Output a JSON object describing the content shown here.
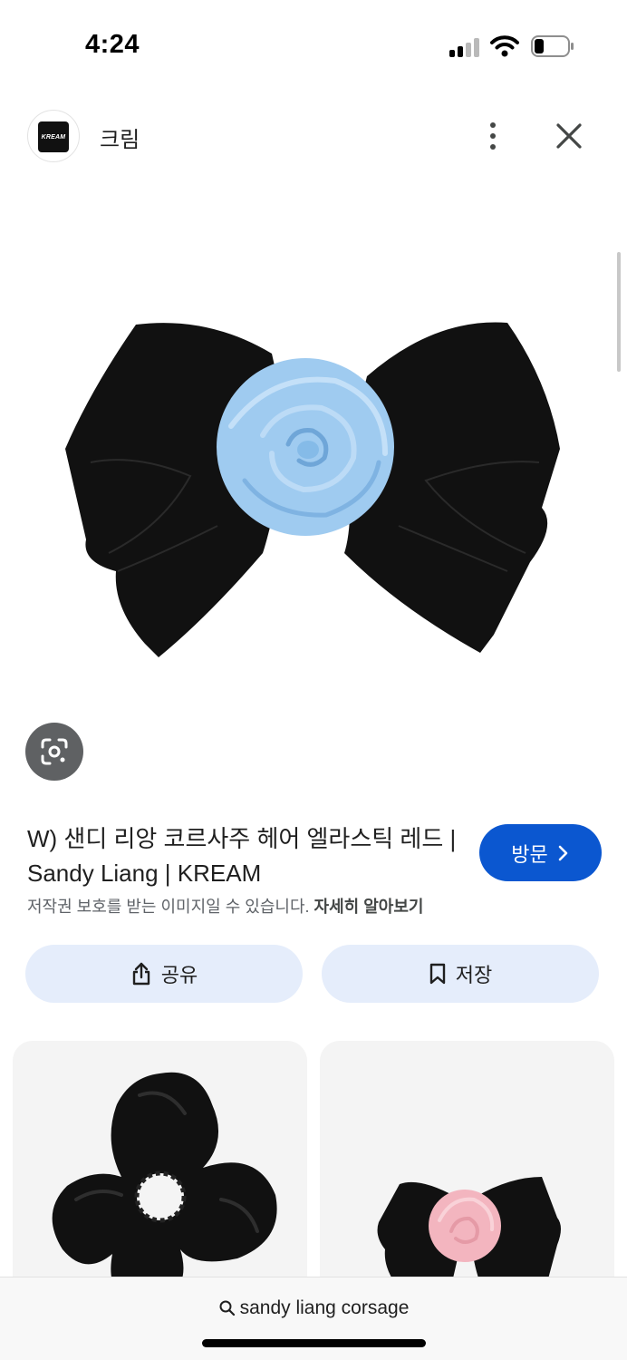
{
  "status_bar": {
    "time": "4:24"
  },
  "header": {
    "logo_text": "KREAM",
    "site_name": "크림"
  },
  "result": {
    "title": "W) 샌디 리앙 코르사주 헤어 엘라스틱 레드 | Sandy Liang | KREAM",
    "copyright_notice": "저작권 보호를 받는 이미지일 수 있습니다.",
    "learn_more": "자세히 알아보기",
    "visit_label": "방문",
    "share_label": "공유",
    "save_label": "저장"
  },
  "search": {
    "query": "sandy liang corsage"
  },
  "colors": {
    "accent_blue": "#0b57d0",
    "chip_background": "#e5edfb",
    "bow_black": "#111111",
    "flower_blue": "#9fcbf0",
    "flower_pink": "#f3b5bf"
  },
  "icons": {
    "lens": "lens-icon",
    "share": "share-icon",
    "save": "bookmark-icon",
    "more": "more-vertical-icon",
    "close": "close-icon",
    "search": "search-icon"
  }
}
